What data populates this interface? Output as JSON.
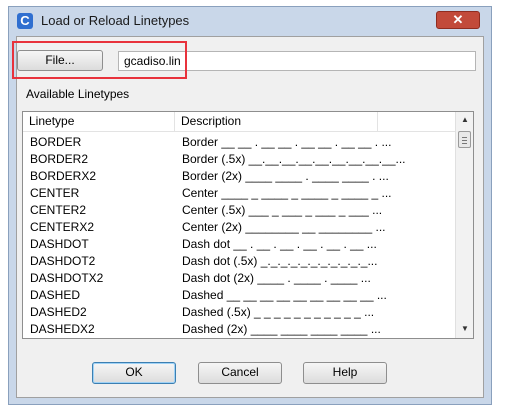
{
  "window": {
    "title": "Load or Reload Linetypes",
    "close_glyph": "✕",
    "app_icon_glyph": "C"
  },
  "file": {
    "button_label": "File...",
    "value": "gcadiso.lin"
  },
  "available_label": "Available Linetypes",
  "columns": {
    "linetype": "Linetype",
    "description": "Description"
  },
  "linetypes": [
    {
      "name": "BORDER",
      "description": "Border __ __ . __ __ . __ __ . __ __ . ..."
    },
    {
      "name": "BORDER2",
      "description": "Border (.5x) __.__.__.__.__.__.__.__.__..."
    },
    {
      "name": "BORDERX2",
      "description": "Border (2x) ____ ____ . ____ ____ . ..."
    },
    {
      "name": "CENTER",
      "description": "Center ____ _ ____ _ ____ _ ____ _ ..."
    },
    {
      "name": "CENTER2",
      "description": "Center (.5x) ___ _ ___ _ ___ _ ___ ..."
    },
    {
      "name": "CENTERX2",
      "description": "Center (2x) ________ __ ________ ..."
    },
    {
      "name": "DASHDOT",
      "description": "Dash dot __ . __ . __ . __ . __ . __ ..."
    },
    {
      "name": "DASHDOT2",
      "description": "Dash dot (.5x) _._._._._._._._._._._..."
    },
    {
      "name": "DASHDOTX2",
      "description": "Dash dot (2x) ____ . ____ . ____ ..."
    },
    {
      "name": "DASHED",
      "description": "Dashed __ __ __ __ __ __ __ __ __ ..."
    },
    {
      "name": "DASHED2",
      "description": "Dashed (.5x) _ _ _ _ _ _ _ _ _ _ _ ..."
    },
    {
      "name": "DASHEDX2",
      "description": "Dashed (2x) ____ ____ ____ ____ ..."
    }
  ],
  "scrollbar": {
    "up_glyph": "▲",
    "down_glyph": "▼"
  },
  "buttons": {
    "ok": "OK",
    "cancel": "Cancel",
    "help": "Help"
  },
  "colors": {
    "highlight": "#e8323c",
    "title_bar": "#c9d7e9",
    "close_button": "#c24a3a"
  }
}
